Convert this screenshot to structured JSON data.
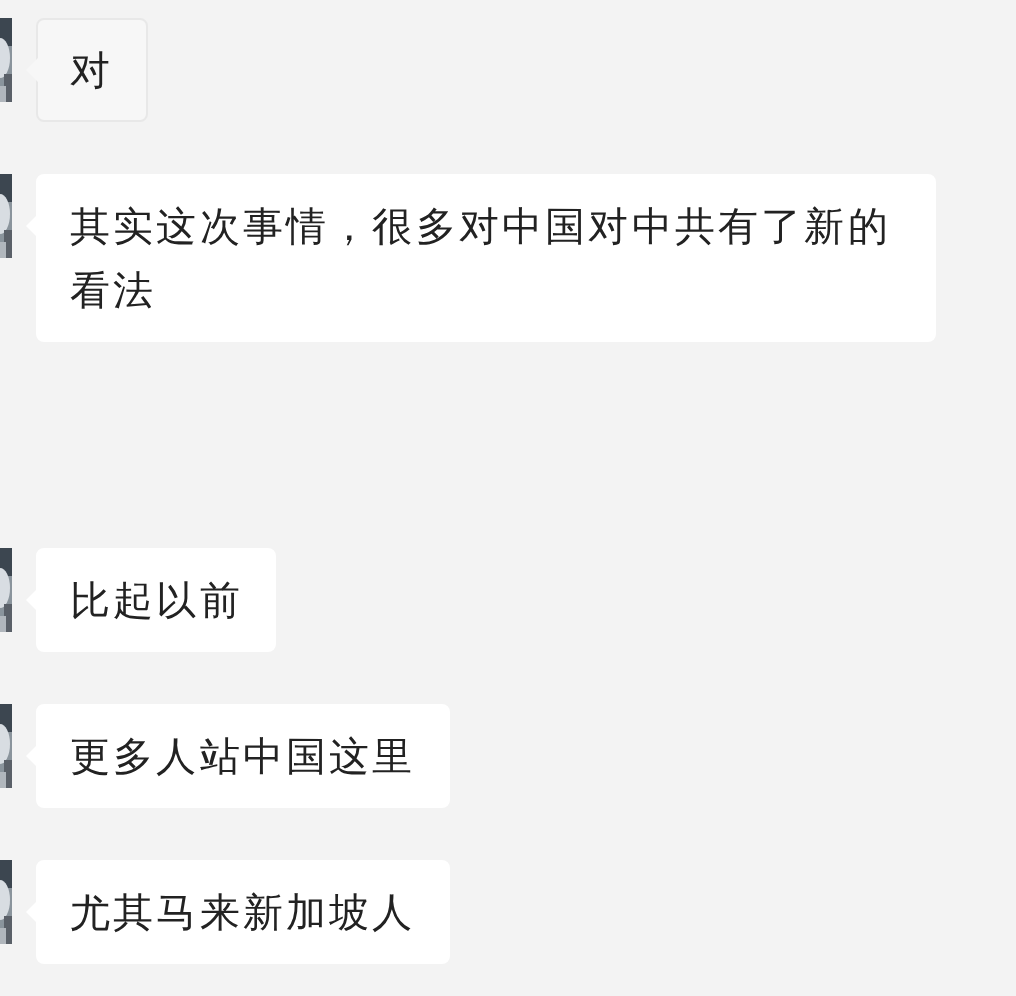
{
  "messages": [
    {
      "text": "对",
      "highlighted": true
    },
    {
      "text": "其实这次事情，很多对中国对中共有了新的看法",
      "highlighted": false
    },
    {
      "text": "比起以前",
      "highlighted": false
    },
    {
      "text": "更多人站中国这里",
      "highlighted": false
    },
    {
      "text": "尤其马来新加坡人",
      "highlighted": false
    }
  ]
}
